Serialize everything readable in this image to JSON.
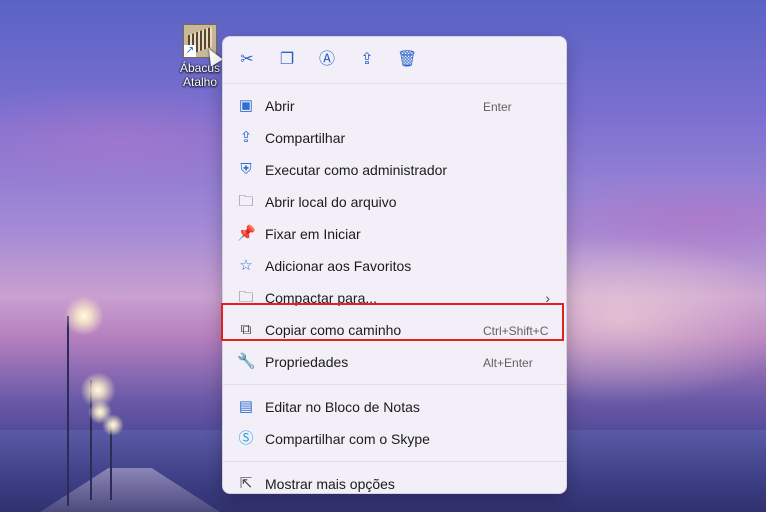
{
  "desktop_icon": {
    "name_line1": "Ábacus",
    "name_line2": "Atalho"
  },
  "context_menu": {
    "toolbar": [
      {
        "icon": "cut-icon"
      },
      {
        "icon": "copy-icon"
      },
      {
        "icon": "rename-icon"
      },
      {
        "icon": "share-icon"
      },
      {
        "icon": "delete-icon"
      }
    ],
    "items": [
      {
        "label": "Abrir",
        "shortcut": "Enter",
        "icon": "open-icon"
      },
      {
        "label": "Compartilhar",
        "shortcut": "",
        "icon": "share-icon"
      },
      {
        "label": "Executar como administrador",
        "shortcut": "",
        "icon": "admin-shield-icon"
      },
      {
        "label": "Abrir local do arquivo",
        "shortcut": "",
        "icon": "folder-icon"
      },
      {
        "label": "Fixar em Iniciar",
        "shortcut": "",
        "icon": "pin-icon"
      },
      {
        "label": "Adicionar aos Favoritos",
        "shortcut": "",
        "icon": "star-icon"
      },
      {
        "label": "Compactar para...",
        "shortcut": "",
        "icon": "zip-folder-icon",
        "submenu": true
      },
      {
        "label": "Copiar como caminho",
        "shortcut": "Ctrl+Shift+C",
        "icon": "copy-path-icon"
      },
      {
        "label": "Propriedades",
        "shortcut": "Alt+Enter",
        "icon": "wrench-icon",
        "highlighted": true
      },
      {
        "label": "Editar no Bloco de Notas",
        "shortcut": "",
        "icon": "notepad-icon"
      },
      {
        "label": "Compartilhar com o Skype",
        "shortcut": "",
        "icon": "skype-icon"
      },
      {
        "label": "Mostrar mais opções",
        "shortcut": "",
        "icon": "more-options-icon"
      }
    ],
    "highlight_color": "#e0231f"
  }
}
